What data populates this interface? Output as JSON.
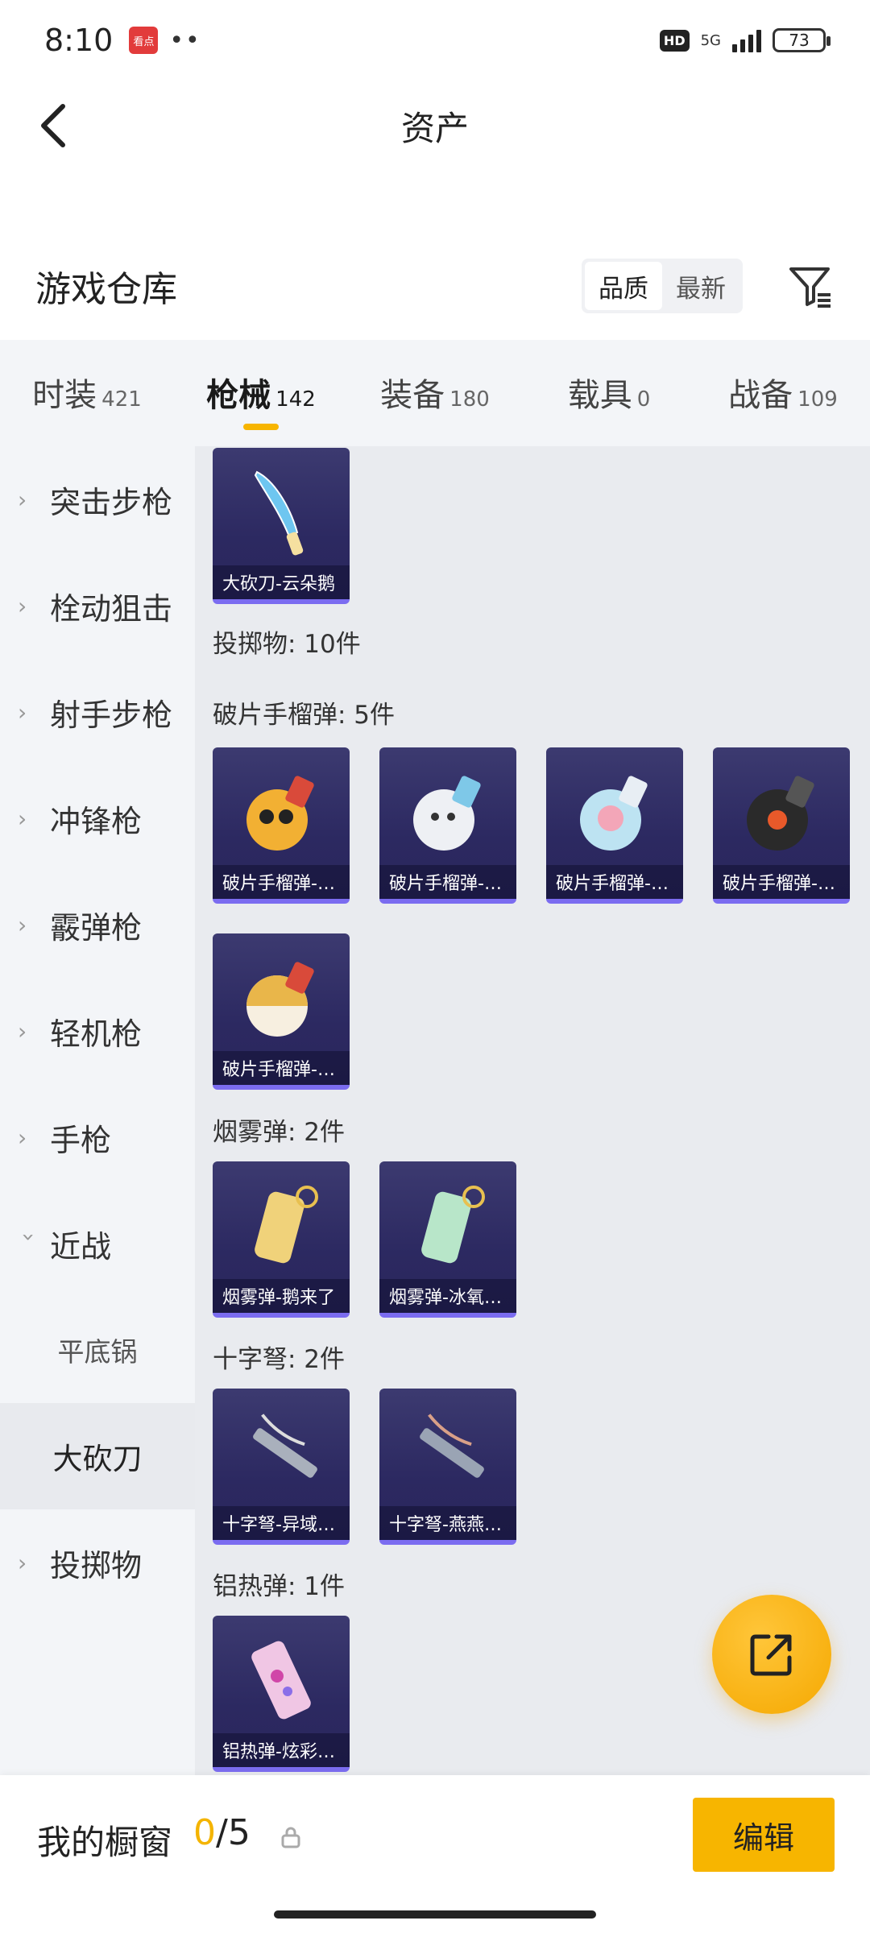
{
  "status_bar": {
    "time": "8:10",
    "app_badge": "看点",
    "dots": "••",
    "hd": "HD",
    "network": "5G",
    "battery": "73"
  },
  "header": {
    "title": "资产",
    "back_icon": "chevron-left-icon"
  },
  "warehouse": {
    "title": "游戏仓库",
    "sort_options": [
      "品质",
      "最新"
    ],
    "active_sort": "品质",
    "filter_icon": "filter-icon"
  },
  "tabs": [
    {
      "label": "时装",
      "count": "421"
    },
    {
      "label": "枪械",
      "count": "142",
      "active": true
    },
    {
      "label": "装备",
      "count": "180"
    },
    {
      "label": "载具",
      "count": "0"
    },
    {
      "label": "战备",
      "count": "109"
    }
  ],
  "sidebar": {
    "items": [
      {
        "label": "突击步枪"
      },
      {
        "label": "栓动狙击"
      },
      {
        "label": "射手步枪"
      },
      {
        "label": "冲锋枪"
      },
      {
        "label": "霰弹枪"
      },
      {
        "label": "轻机枪"
      },
      {
        "label": "手枪"
      },
      {
        "label": "近战",
        "expanded": true
      },
      {
        "label": "投掷物"
      }
    ],
    "sub_items": [
      {
        "label": "平底锅"
      },
      {
        "label": "大砍刀",
        "active": true
      }
    ]
  },
  "content": {
    "top_item": {
      "caption": "大砍刀-云朵鹅"
    },
    "throwables_label": "投掷物: 10件",
    "groups": [
      {
        "label": "破片手榴弹: 5件",
        "items": [
          "破片手榴弹-…",
          "破片手榴弹-…",
          "破片手榴弹-…",
          "破片手榴弹-…",
          "破片手榴弹-…"
        ]
      },
      {
        "label": "烟雾弹: 2件",
        "items": [
          "烟雾弹-鹅来了",
          "烟雾弹-冰氧…"
        ]
      },
      {
        "label": "十字弩: 2件",
        "items": [
          "十字弩-异域…",
          "十字弩-燕燕…"
        ]
      },
      {
        "label": "铝热弹: 1件",
        "items": [
          "铝热弹-炫彩…"
        ]
      }
    ]
  },
  "fab_icon": "share-icon",
  "bottom_bar": {
    "showcase_label": "我的橱窗",
    "current": "0",
    "total": "/5",
    "lock_icon": "lock-icon",
    "edit_label": "编辑"
  },
  "colors": {
    "accent": "#f7b500",
    "card_bg": "#2c2961",
    "card_border": "#7b6cf0"
  }
}
